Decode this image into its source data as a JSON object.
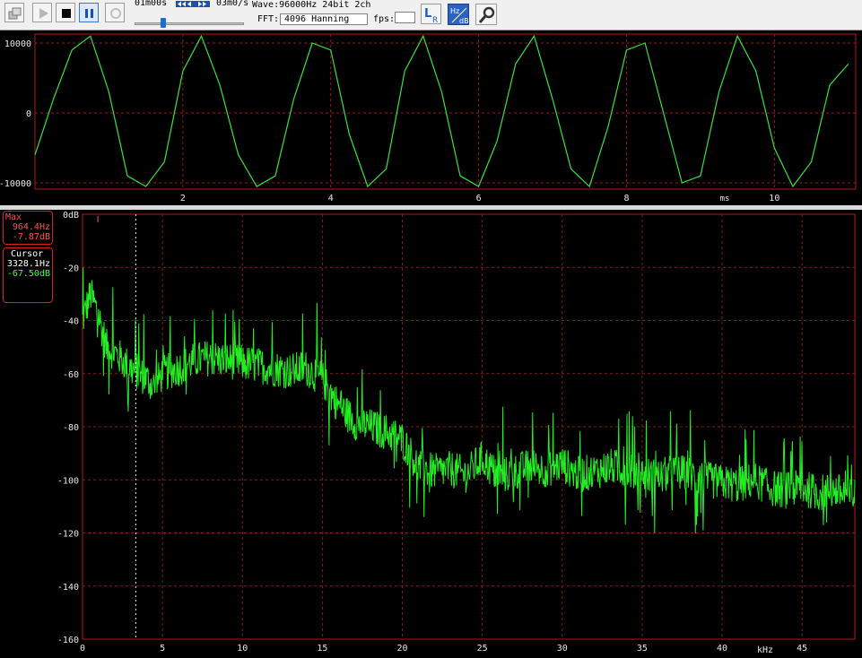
{
  "toolbar": {
    "buttons": [
      {
        "name": "record-button",
        "icon": "record-icon",
        "active": false
      },
      {
        "name": "play-button",
        "icon": "play-icon",
        "active": false
      },
      {
        "name": "stop-button",
        "icon": "stop-icon",
        "active": false
      },
      {
        "name": "pause-button",
        "icon": "pause-icon",
        "active": true
      },
      {
        "name": "loop-button",
        "icon": "loop-icon",
        "active": false
      }
    ],
    "time_text": "01m00s",
    "speed_text": "03m0/s",
    "wave_info": "Wave:96000Hz 24bit 2ch",
    "fft_label": "FFT:",
    "fft_value": "4096 Hanning",
    "fps_label": "fps:",
    "fps_value": "",
    "position_fraction": 0.26,
    "right_icons": [
      "lr-channel-icon",
      "hz-db-icon",
      "settings-wrench-icon"
    ]
  },
  "waveform": {
    "y_ticks": [
      "10000",
      "0",
      "-10000"
    ],
    "x_ticks": [
      "2",
      "4",
      "6",
      "8",
      "10"
    ],
    "x_unit": "ms",
    "colors": {
      "trace": "#38e040",
      "frame": "#b01818",
      "grid": "#9a1a1a",
      "text": "#e8e8e8"
    }
  },
  "spectrum": {
    "info": {
      "max_title": "Max",
      "max_freq": "964.4Hz",
      "max_db": "-7.87dB",
      "cursor_title": "Cursor",
      "cursor_freq": "3328.1Hz",
      "cursor_db": "-67.50dB"
    },
    "y_ticks": [
      "0dB",
      "-20",
      "-40",
      "-60",
      "-80",
      "-100",
      "-120",
      "-140",
      "-160"
    ],
    "x_ticks": [
      "0",
      "5",
      "10",
      "15",
      "20",
      "25",
      "30",
      "35",
      "40",
      "45"
    ],
    "x_unit": "kHz",
    "cursor_khz": 3.33,
    "colors": {
      "trace": "#22ee22",
      "frame": "#b01818",
      "grid": "#8a1818",
      "text": "#e8e8e8",
      "cursor": "#f0f0f0",
      "max_text": "#ff5050",
      "cursor_text": "#ffffff",
      "value_text": "#40ff40"
    }
  },
  "chart_data": [
    {
      "type": "line",
      "series": [
        {
          "name": "",
          "x": [
            0,
            0.25,
            0.5,
            0.75,
            1,
            1.25,
            1.5,
            1.75,
            2,
            2.25,
            2.5,
            2.75,
            3,
            3.25,
            3.5,
            3.75,
            4,
            4.25,
            4.5,
            4.75,
            5,
            5.25,
            5.5,
            5.75,
            6,
            6.25,
            6.5,
            6.75,
            7,
            7.25,
            7.5,
            7.75,
            8,
            8.25,
            8.5,
            8.75,
            9,
            9.25,
            9.5,
            9.75,
            10,
            10.25,
            10.5,
            10.75,
            11
          ],
          "values": [
            -6000,
            2000,
            9000,
            11000,
            3000,
            -9000,
            -11000,
            -7000,
            6000,
            11000,
            4000,
            -6000,
            -11000,
            -9000,
            2000,
            10000,
            9000,
            -3000,
            -11000,
            -8000,
            6000,
            11000,
            3000,
            -9000,
            -11000,
            -4000,
            7000,
            11000,
            2000,
            -8000,
            -11000,
            -2000,
            9000,
            10000,
            0,
            -10000,
            -9000,
            3000,
            11000,
            6000,
            -5000,
            -11000,
            -7000,
            4000,
            7000
          ]
        }
      ],
      "xlabel": "ms",
      "ylim": [
        -11000,
        11000
      ],
      "xlim": [
        0,
        11.1
      ],
      "grid": true
    },
    {
      "type": "line",
      "series": [
        {
          "name": "",
          "x": [
            0,
            0.5,
            1,
            1.5,
            2,
            2.5,
            3,
            3.5,
            4,
            4.5,
            5,
            6,
            7,
            8,
            9,
            10,
            11,
            12,
            13,
            14,
            15,
            16,
            17,
            18,
            19,
            20,
            21,
            22,
            23,
            24,
            25,
            26,
            27,
            28,
            29,
            30,
            31,
            32,
            33,
            34,
            35,
            36,
            37,
            38,
            39,
            40,
            41,
            42,
            43,
            44,
            45,
            46,
            47,
            48
          ],
          "values": [
            -40,
            -30,
            -38,
            -50,
            -52,
            -55,
            -58,
            -60,
            -62,
            -65,
            -60,
            -58,
            -55,
            -54,
            -55,
            -56,
            -57,
            -58,
            -59,
            -58,
            -62,
            -72,
            -78,
            -80,
            -82,
            -85,
            -95,
            -97,
            -96,
            -98,
            -92,
            -99,
            -97,
            -95,
            -96,
            -94,
            -98,
            -97,
            -95,
            -96,
            -98,
            -99,
            -97,
            -98,
            -100,
            -101,
            -102,
            -100,
            -103,
            -104,
            -103,
            -105,
            -104,
            -106
          ]
        }
      ],
      "xlabel": "kHz",
      "ylabel": "",
      "ylim": [
        -160,
        0
      ],
      "xlim": [
        0,
        48.3
      ],
      "grid": true
    }
  ]
}
